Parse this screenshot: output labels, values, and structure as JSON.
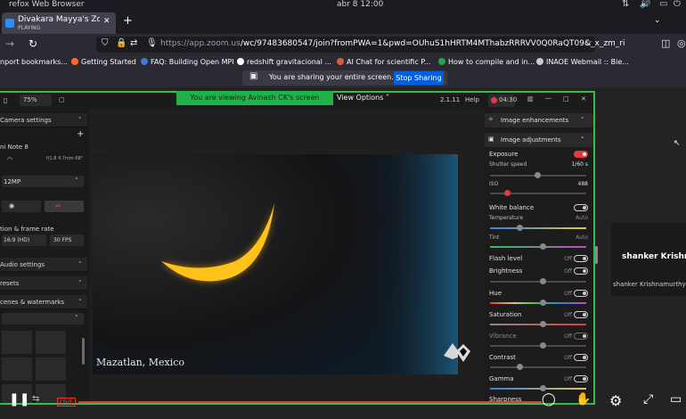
{
  "system": {
    "browser_name": "refox Web Browser",
    "datetime": "abr 8  12:00"
  },
  "tab": {
    "title": "Divakara Mayya's Zoom M",
    "subtitle": "PLAYING",
    "close": "✕",
    "new": "+"
  },
  "nav": {
    "url_dim": "https://app.zoom.us",
    "url_main": "/wc/97483680547/join?fromPWA=1&pwd=OUhuS1hHRTM4MThabzRRRVV0Q0RaQT09&_x_zm_ri"
  },
  "bookmarks": [
    {
      "label": "nport bookmarks...",
      "color": "#8a8a8a"
    },
    {
      "label": "Getting Started",
      "color": "#ff6a2a"
    },
    {
      "label": "FAQ: Building Open MPI",
      "color": "#3e7bd6"
    },
    {
      "label": "redshift gravitacional ...",
      "color": "#ffffff"
    },
    {
      "label": "AI Chat for scientific P...",
      "color": "#d85c3a"
    },
    {
      "label": "How to compile and in...",
      "color": "#27a34d"
    },
    {
      "label": "INAOE Webmail :: Bie...",
      "color": "#c9c9c9"
    }
  ],
  "sharing": {
    "text": "You are sharing your entire screen.",
    "button": "Stop Sharing"
  },
  "zoom": {
    "viewing": "You are viewing  Avinash CK's screen",
    "view_options": "View Options"
  },
  "app": {
    "zoom_level": "75%",
    "version": "2.1.11",
    "help": "Help",
    "rec_time": "04:30",
    "left": {
      "camera_settings": "Camera settings",
      "device": "ni Note 8",
      "lens": "f/1.8  4.7mm  68°",
      "resolution_mp": "12MP",
      "res_frame_rate": "tion & frame rate",
      "res_value": "16:9 (HD)",
      "fps_value": "30 FPS",
      "audio_settings": "Audio settings",
      "presets": "resets",
      "scenes": "cenes & watermarks"
    },
    "preview_caption": "Mazatlan, Mexico",
    "right": {
      "image_enhancements": "Image enhancements",
      "image_adjustments": "Image adjustments",
      "exposure": "Exposure",
      "shutter_speed": "Shutter speed",
      "shutter_value": "1/60 s",
      "iso": "ISO",
      "iso_value": "488",
      "white_balance": "White balance",
      "temperature": "Temperature",
      "temperature_value": "Auto",
      "tint": "Tint",
      "tint_value": "Auto",
      "flash_level": "Flash level",
      "brightness": "Brightness",
      "hue": "Hue",
      "saturation": "Saturation",
      "vibrance": "Vibrance",
      "contrast": "Contrast",
      "gamma": "Gamma",
      "sharpness": "Sharpness",
      "off": "Off"
    }
  },
  "participant": {
    "name_large": "shanker Krishna",
    "name_small": "shanker Krishnamurthy"
  },
  "bottom": {
    "live": "LIVE"
  }
}
